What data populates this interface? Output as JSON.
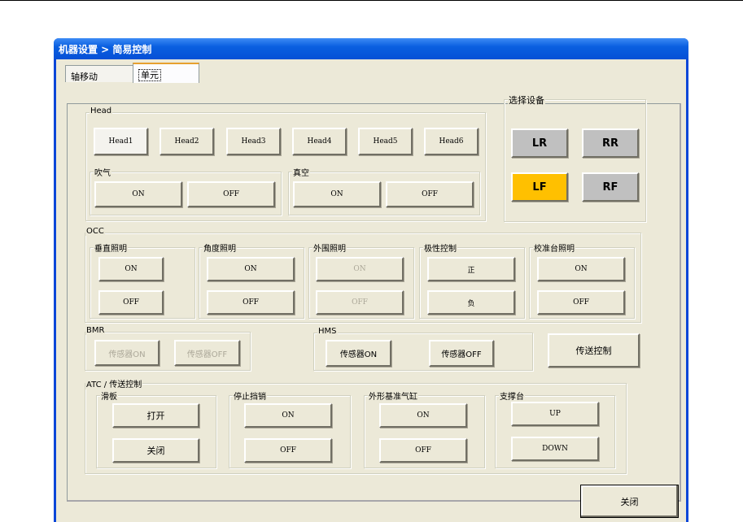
{
  "window": {
    "title": "机器设置 > 简易控制"
  },
  "tabs": [
    {
      "label": "轴移动"
    },
    {
      "label": "单元"
    }
  ],
  "head": {
    "label": "Head",
    "buttons": [
      "Head1",
      "Head2",
      "Head3",
      "Head4",
      "Head5",
      "Head6"
    ],
    "blow": {
      "label": "吹气",
      "on": "ON",
      "off": "OFF"
    },
    "vacuum": {
      "label": "真空",
      "on": "ON",
      "off": "OFF"
    }
  },
  "device": {
    "label": "选择设备",
    "buttons": [
      "LR",
      "RR",
      "LF",
      "RF"
    ],
    "selected": "LF",
    "selected_color": "#ffc000"
  },
  "occ": {
    "label": "OCC",
    "groups": [
      {
        "label": "垂直照明",
        "on": "ON",
        "off": "OFF"
      },
      {
        "label": "角度照明",
        "on": "ON",
        "off": "OFF"
      },
      {
        "label": "外围照明",
        "on": "ON",
        "off": "OFF"
      },
      {
        "label": "极性控制",
        "on": "正",
        "off": "负"
      },
      {
        "label": "校准台照明",
        "on": "ON",
        "off": "OFF"
      }
    ]
  },
  "bmr": {
    "label": "BMR",
    "on": "传感器ON",
    "off": "传感器OFF"
  },
  "hms": {
    "label": "HMS",
    "on": "传感器ON",
    "off": "传感器OFF"
  },
  "transfer_button": "传送控制",
  "atc": {
    "label": "ATC / 传送控制",
    "groups": [
      {
        "label": "滑板",
        "on": "打开",
        "off": "关闭"
      },
      {
        "label": "停止挡销",
        "on": "ON",
        "off": "OFF"
      },
      {
        "label": "外形基准气缸",
        "on": "ON",
        "off": "OFF"
      },
      {
        "label": "支撑台",
        "on": "UP",
        "off": "DOWN"
      }
    ]
  },
  "close_button": "关闭"
}
